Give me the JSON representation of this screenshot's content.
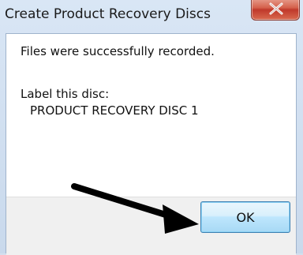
{
  "dialog": {
    "title": "Create Product Recovery Discs",
    "close_icon": "close-icon"
  },
  "content": {
    "message": "Files were successfully recorded.",
    "label_prompt": "Label this disc:",
    "label_value": "PRODUCT RECOVERY DISC 1"
  },
  "buttons": {
    "ok_label": "OK"
  },
  "annotation": {
    "icon": "arrow-pointer-icon",
    "color": "#000000"
  },
  "colors": {
    "close_button": "#c0392b",
    "ok_button_border": "#3c7fb1",
    "frame": "#d3dfee"
  }
}
